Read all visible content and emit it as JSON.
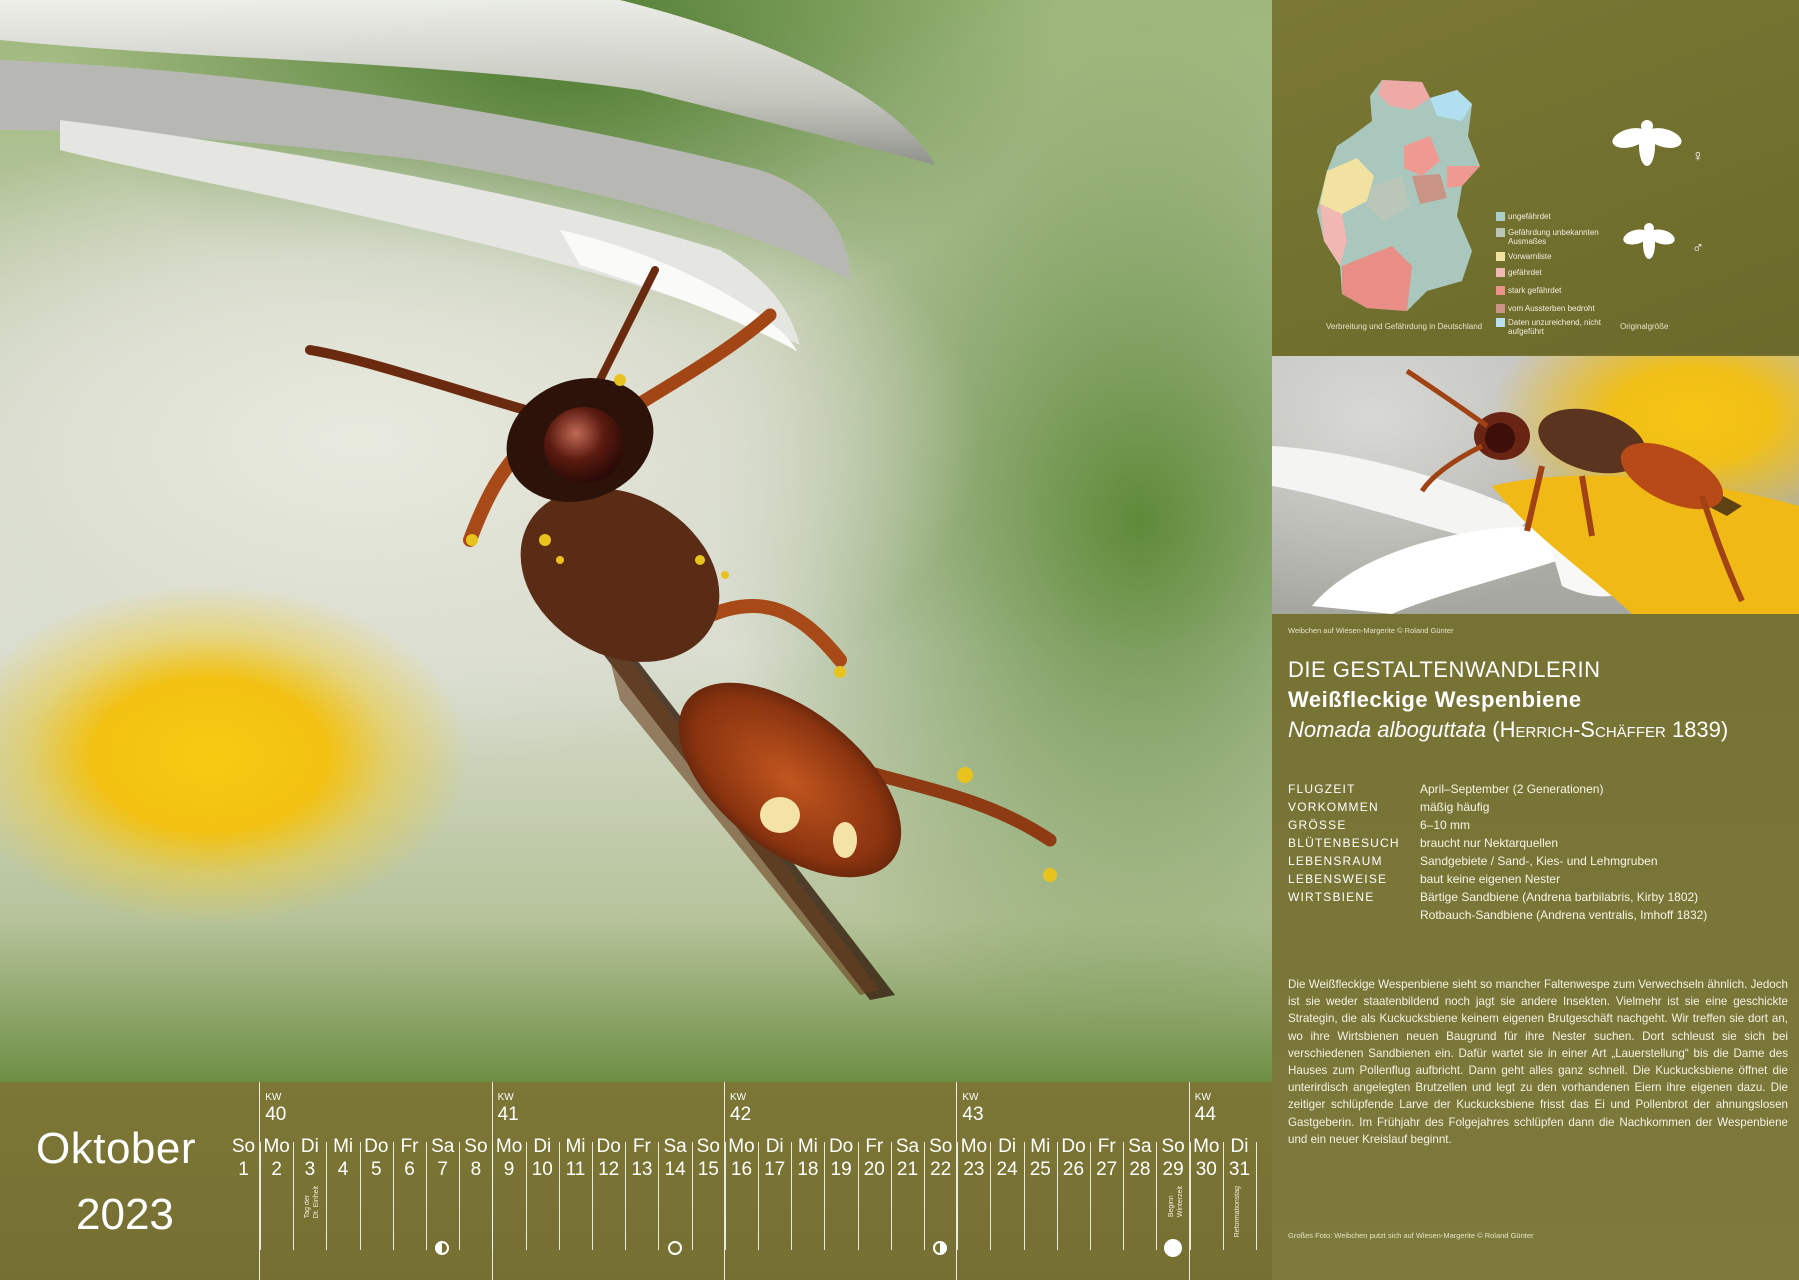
{
  "calendar": {
    "month": "Oktober",
    "year": "2023",
    "week_label": "KW",
    "weeks": [
      "40",
      "41",
      "42",
      "43",
      "44"
    ],
    "days": [
      {
        "dn": "So",
        "d": "1"
      },
      {
        "dn": "Mo",
        "d": "2"
      },
      {
        "dn": "Di",
        "d": "3"
      },
      {
        "dn": "Mi",
        "d": "4"
      },
      {
        "dn": "Do",
        "d": "5"
      },
      {
        "dn": "Fr",
        "d": "6"
      },
      {
        "dn": "Sa",
        "d": "7"
      },
      {
        "dn": "So",
        "d": "8"
      },
      {
        "dn": "Mo",
        "d": "9"
      },
      {
        "dn": "Di",
        "d": "10"
      },
      {
        "dn": "Mi",
        "d": "11"
      },
      {
        "dn": "Do",
        "d": "12"
      },
      {
        "dn": "Fr",
        "d": "13"
      },
      {
        "dn": "Sa",
        "d": "14"
      },
      {
        "dn": "So",
        "d": "15"
      },
      {
        "dn": "Mo",
        "d": "16"
      },
      {
        "dn": "Di",
        "d": "17"
      },
      {
        "dn": "Mi",
        "d": "18"
      },
      {
        "dn": "Do",
        "d": "19"
      },
      {
        "dn": "Fr",
        "d": "20"
      },
      {
        "dn": "Sa",
        "d": "21"
      },
      {
        "dn": "So",
        "d": "22"
      },
      {
        "dn": "Mo",
        "d": "23"
      },
      {
        "dn": "Di",
        "d": "24"
      },
      {
        "dn": "Mi",
        "d": "25"
      },
      {
        "dn": "Do",
        "d": "26"
      },
      {
        "dn": "Fr",
        "d": "27"
      },
      {
        "dn": "Sa",
        "d": "28"
      },
      {
        "dn": "So",
        "d": "29"
      },
      {
        "dn": "Mo",
        "d": "30"
      },
      {
        "dn": "Di",
        "d": "31"
      }
    ],
    "notes": {
      "tag_der_einheit": "Tag der\nDt. Einheit",
      "winterzeit": "Beginn\nWinterzeit",
      "reformationstag": "Reformationstag"
    },
    "moon_phases": [
      "last-quarter-moon-icon",
      "new-moon-icon",
      "first-quarter-moon-icon",
      "full-moon-icon"
    ]
  },
  "map": {
    "caption": "Verbreitung und Gefährdung in Deutschland",
    "size_caption": "Originalgröße",
    "female_symbol": "♀",
    "male_symbol": "♂",
    "legend": [
      {
        "label": "ungefährdet",
        "color": "#a9cfc6"
      },
      {
        "label": "Gefährdung unbekannten Ausmaßes",
        "color": "#b9c6b8"
      },
      {
        "label": "Vorwarnliste",
        "color": "#f1e4a3"
      },
      {
        "label": "gefährdet",
        "color": "#f1b7b3"
      },
      {
        "label": "stark gefährdet",
        "color": "#eb938a"
      },
      {
        "label": "vom Aussterben bedroht",
        "color": "#c99485"
      },
      {
        "label": "Daten unzureichend, nicht aufgeführt",
        "color": "#b9e0ee"
      }
    ]
  },
  "photo2": {
    "caption": "Weibchen auf Wiesen-Margerite © Roland Günter"
  },
  "species": {
    "heading": "DIE GESTALTENWANDLERIN",
    "common_name": "Weißfleckige Wespenbiene",
    "scientific_name": "Nomada alboguttata",
    "author": "Herrich-Schäffer",
    "author_year": "1839",
    "facts": [
      {
        "key": "FLUGZEIT",
        "value": "April–September (2 Generationen)"
      },
      {
        "key": "VORKOMMEN",
        "value": "mäßig häufig"
      },
      {
        "key": "GRÖSSE",
        "value": "6–10 mm"
      },
      {
        "key": "BLÜTENBESUCH",
        "value": "braucht nur Nektarquellen"
      },
      {
        "key": "LEBENSRAUM",
        "value": "Sandgebiete / Sand-, Kies- und Lehmgruben"
      },
      {
        "key": "LEBENSWEISE",
        "value": "baut keine eigenen Nester"
      },
      {
        "key": "WIRTSBIENE",
        "value": "Bärtige Sandbiene (Andrena barbilabris, Kirby 1802)"
      },
      {
        "key": "",
        "value": "Rotbauch-Sandbiene (Andrena ventralis, Imhoff 1832)"
      }
    ],
    "description": "Die Weißfleckige Wespenbiene sieht so mancher Faltenwespe zum Verwechseln ähnlich. Jedoch ist sie weder staatenbildend noch jagt sie andere Insekten. Vielmehr ist sie eine geschickte Strategin, die als Kuckucksbiene keinem eigenen Brutgeschäft nachgeht. Wir treffen sie dort an, wo ihre Wirtsbienen neuen Baugrund für ihre Nester suchen. Dort schleust sie sich bei verschiedenen Sandbienen ein. Dafür wartet sie in einer Art „Lauerstellung“ bis die Dame des Hauses zum Pollenflug aufbricht. Dann geht alles ganz schnell. Die Kuckucksbiene öffnet die unterirdisch angelegten Brutzellen und legt zu den vorhandenen Eiern ihre eigenen dazu. Die zeitiger schlüpfende Larve der Kuckucksbiene frisst das Ei und Pollenbrot der ahnungslosen Gastgeberin. Im Frühjahr des Folgejahres schlüpfen dann die Nachkommen der Wespenbiene und ein neuer Kreislauf beginnt.",
    "main_photo_credit": "Großes Foto: Weibchen putzt sich auf Wiesen-Margerite © Roland Günter"
  }
}
